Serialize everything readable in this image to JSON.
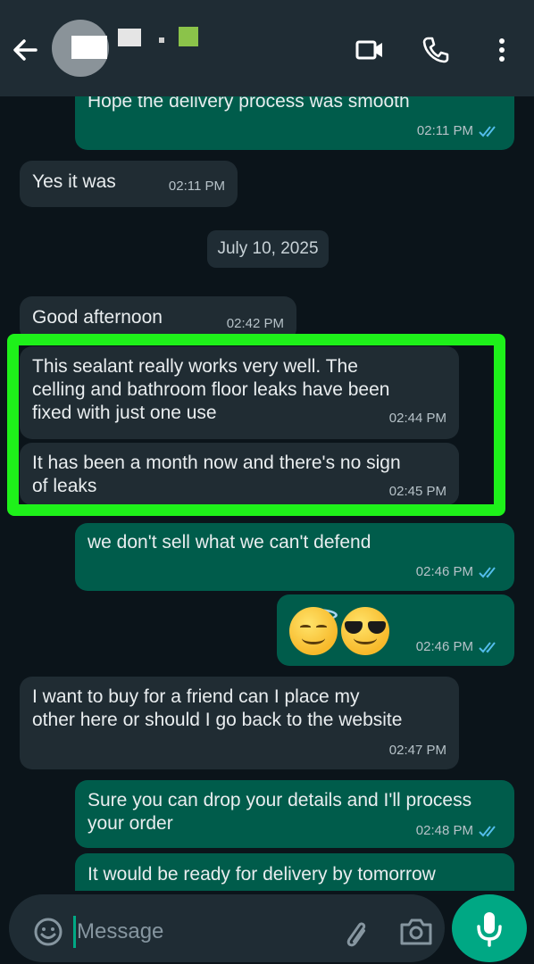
{
  "header": {
    "contact_name": "",
    "icons": [
      "arrow-left-icon",
      "video-camera-icon",
      "phone-icon",
      "more-vert-icon"
    ]
  },
  "messages": [
    {
      "dir": "out",
      "text": [
        "Hope the delivery process was smooth"
      ],
      "time": "02:11 PM",
      "read": true
    },
    {
      "dir": "in",
      "text": [
        "Yes it was"
      ],
      "time": "02:11 PM"
    },
    {
      "dir": "date",
      "text": [
        "July 10, 2025"
      ]
    },
    {
      "dir": "in",
      "text": [
        "Good afternoon"
      ],
      "time": "02:42 PM"
    },
    {
      "dir": "in",
      "text": [
        "This sealant really works very well. The",
        "celling and bathroom floor leaks have been",
        "fixed with just one use"
      ],
      "time": "02:44 PM"
    },
    {
      "dir": "in",
      "text": [
        "It has been a month now and there's no sign",
        "of leaks"
      ],
      "time": "02:45 PM"
    },
    {
      "dir": "out",
      "text": [
        "we don't sell what we can't defend"
      ],
      "time": "02:46 PM",
      "read": true
    },
    {
      "dir": "out",
      "text": [
        "😇😎"
      ],
      "time": "02:46 PM",
      "read": true
    },
    {
      "dir": "in",
      "text": [
        "I want to buy for a friend can I place my",
        "other here or should I go back to the website"
      ],
      "time": "02:47 PM"
    },
    {
      "dir": "out",
      "text": [
        "Sure you can drop your details and I'll process",
        "your order"
      ],
      "time": "02:48 PM",
      "read": true
    },
    {
      "dir": "out",
      "text": [
        "It would be ready for delivery by tomorrow"
      ],
      "time": ""
    }
  ],
  "composer": {
    "placeholder": "Message",
    "icons": [
      "emoji-icon",
      "paperclip-icon",
      "camera-icon",
      "microphone-icon"
    ]
  },
  "colors": {
    "background": "#0b141a",
    "incoming": "#202c33",
    "outgoing": "#005c4b",
    "read_tick": "#53bdeb",
    "highlight": "#1ef11a",
    "accent": "#00a884"
  }
}
